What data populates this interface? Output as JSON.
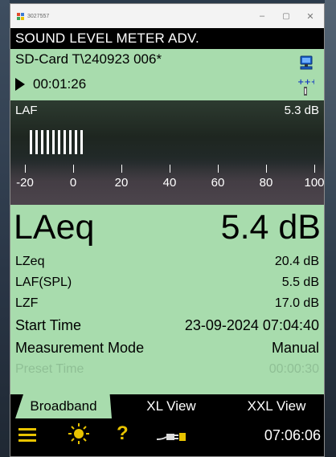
{
  "window": {
    "title": "3027557",
    "controls": {
      "minimize": "–",
      "maximize": "▢",
      "close": "✕"
    }
  },
  "app": {
    "title": "SOUND LEVEL METER ADV."
  },
  "file": {
    "name": "SD-Card T\\240923 006*",
    "elapsed": "00:01:26",
    "icons": {
      "storage": "computer-icon",
      "gps": "gps-antenna-icon",
      "play": "play-icon"
    }
  },
  "meter": {
    "label": "LAF",
    "value": "5.3 dB",
    "bar_level": 5.3,
    "bar_segments": 10,
    "scale_labels": [
      "-20",
      "0",
      "20",
      "40",
      "60",
      "80",
      "100"
    ]
  },
  "main": {
    "label": "LAeq",
    "value": "5.4 dB"
  },
  "rows": [
    {
      "label": "LZeq",
      "value": "20.4 dB"
    },
    {
      "label": "LAF(SPL)",
      "value": "5.5 dB"
    },
    {
      "label": "LZF",
      "value": "17.0 dB"
    },
    {
      "label": "Start Time",
      "value": "23-09-2024 07:04:40"
    },
    {
      "label": "Measurement Mode",
      "value": "Manual"
    },
    {
      "label": "Preset Time",
      "value": "00:00:30"
    }
  ],
  "tabs": [
    {
      "label": "Broadband",
      "active": true
    },
    {
      "label": "XL View",
      "active": false
    },
    {
      "label": "XXL View",
      "active": false
    }
  ],
  "toolbar": {
    "icons": [
      "menu-icon",
      "brightness-icon",
      "help-icon",
      "power-plug-icon"
    ],
    "help_label": "?",
    "clock": "07:06:06"
  },
  "colors": {
    "panel_green": "#a8dcad",
    "accent_yellow": "#e8c300",
    "text_black": "#000000",
    "text_white": "#ffffff",
    "faded_text": "#8fbf95"
  }
}
